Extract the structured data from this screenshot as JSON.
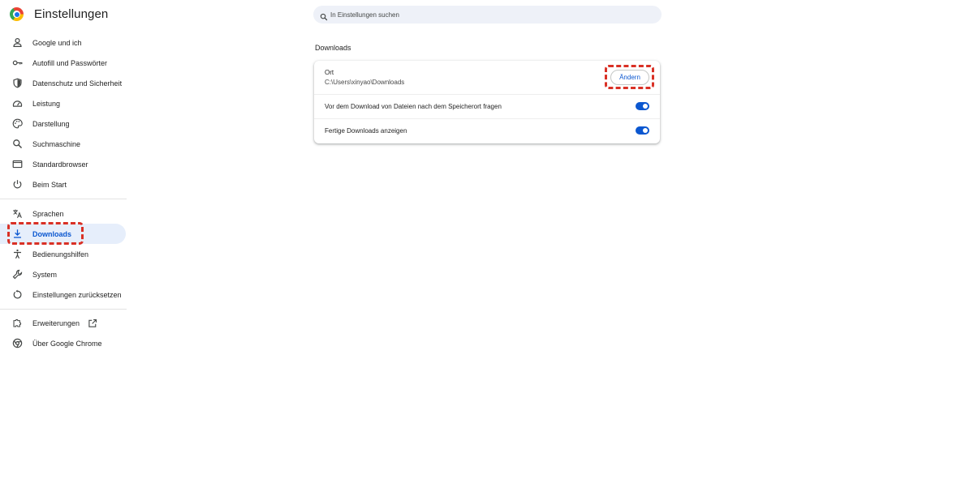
{
  "app": {
    "title": "Einstellungen"
  },
  "search": {
    "placeholder": "In Einstellungen suchen"
  },
  "sidebar": {
    "items": [
      {
        "label": "Google und ich",
        "icon": "person-icon"
      },
      {
        "label": "Autofill und Passwörter",
        "icon": "key-icon"
      },
      {
        "label": "Datenschutz und Sicherheit",
        "icon": "shield-icon"
      },
      {
        "label": "Leistung",
        "icon": "speedometer-icon"
      },
      {
        "label": "Darstellung",
        "icon": "palette-icon"
      },
      {
        "label": "Suchmaschine",
        "icon": "search-icon"
      },
      {
        "label": "Standardbrowser",
        "icon": "browser-window-icon"
      },
      {
        "label": "Beim Start",
        "icon": "power-icon"
      },
      {
        "label": "Sprachen",
        "icon": "translate-icon"
      },
      {
        "label": "Downloads",
        "icon": "download-icon",
        "active": true
      },
      {
        "label": "Bedienungshilfen",
        "icon": "accessibility-icon"
      },
      {
        "label": "System",
        "icon": "wrench-icon"
      },
      {
        "label": "Einstellungen zurücksetzen",
        "icon": "reset-icon"
      },
      {
        "label": "Erweiterungen",
        "icon": "puzzle-icon"
      },
      {
        "label": "Über Google Chrome",
        "icon": "chrome-icon"
      }
    ]
  },
  "downloads": {
    "section_title": "Downloads",
    "location": {
      "label": "Ort",
      "path": "C:\\Users\\xinyao\\Downloads",
      "change_label": "Ändern"
    },
    "ask_where": {
      "label": "Vor dem Download von Dateien nach dem Speicherort fragen",
      "enabled": true
    },
    "show_finished": {
      "label": "Fertige Downloads anzeigen",
      "enabled": true
    }
  },
  "colors": {
    "accent": "#0b57d0",
    "highlight": "#d93025",
    "active_bg": "#e6eefb"
  }
}
